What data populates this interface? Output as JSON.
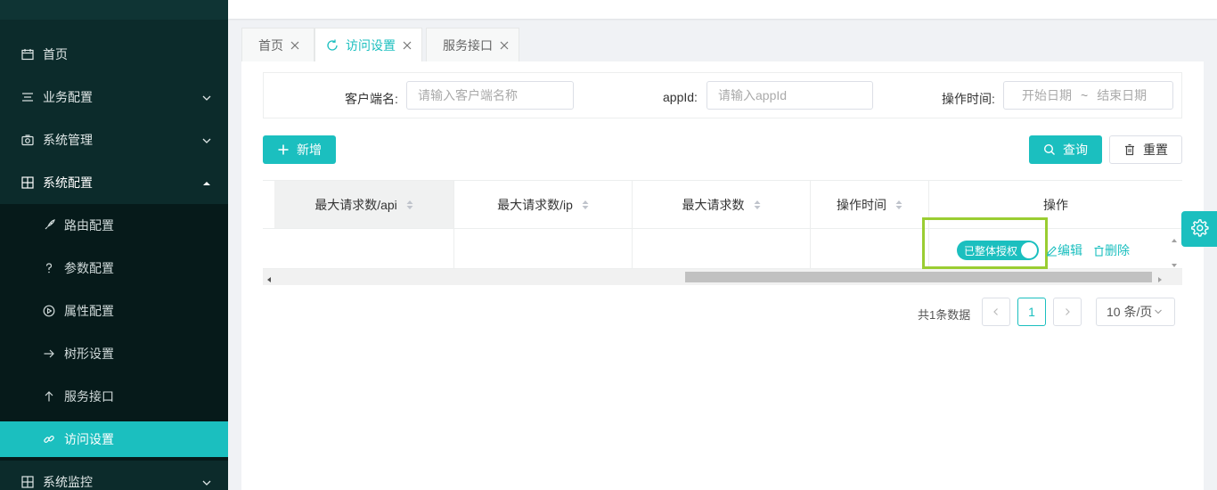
{
  "sidebar": {
    "items": [
      {
        "label": "首页",
        "icon": "calendar-icon"
      },
      {
        "label": "业务配置",
        "icon": "list-icon"
      },
      {
        "label": "系统管理",
        "icon": "camera-icon"
      },
      {
        "label": "系统配置",
        "icon": "grid-icon"
      },
      {
        "label": "系统监控",
        "icon": "grid-icon"
      }
    ],
    "sub_items": [
      {
        "label": "路由配置",
        "icon": "rocket-icon"
      },
      {
        "label": "参数配置",
        "icon": "question-icon"
      },
      {
        "label": "属性配置",
        "icon": "play-circle-icon"
      },
      {
        "label": "树形设置",
        "icon": "arrow-right-icon"
      },
      {
        "label": "服务接口",
        "icon": "arrow-up-icon"
      },
      {
        "label": "访问设置",
        "icon": "link-icon"
      }
    ]
  },
  "tabs": [
    {
      "label": "首页"
    },
    {
      "label": "访问设置"
    },
    {
      "label": "服务接口"
    }
  ],
  "filters": {
    "client_label": "客户端名:",
    "client_placeholder": "请输入客户端名称",
    "appid_label": "appId:",
    "appid_placeholder": "请输入appId",
    "time_label": "操作时间:",
    "start_placeholder": "开始日期",
    "range_sep": "~",
    "end_placeholder": "结束日期"
  },
  "toolbar": {
    "add_label": "新增",
    "query_label": "查询",
    "reset_label": "重置"
  },
  "table": {
    "columns": [
      "最大请求数/api",
      "最大请求数/ip",
      "最大请求数",
      "操作时间",
      "操作"
    ],
    "row": {
      "switch_label": "已整体授权",
      "edit_label": "编辑",
      "delete_label": "删除"
    }
  },
  "pagination": {
    "total_text": "共1条数据",
    "current_page": "1",
    "page_size": "10 条/页"
  },
  "colors": {
    "accent": "#1bbfbf",
    "sidebar": "#0c2b2b",
    "highlight": "#9acd32"
  }
}
